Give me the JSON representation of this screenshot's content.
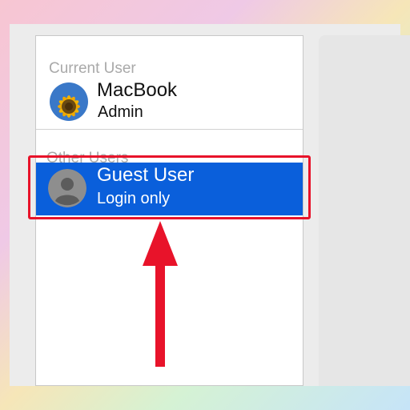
{
  "colors": {
    "selection": "#0a5fdb",
    "highlight": "#e8132a",
    "header_text": "#a9a9a9"
  },
  "users_panel": {
    "current_header": "Current User",
    "current_user": {
      "name": "MacBook",
      "role": "Admin",
      "avatar_icon": "sunflower-avatar-icon"
    },
    "other_header": "Other Users",
    "other_users": [
      {
        "name": "Guest User",
        "role": "Login only",
        "avatar_icon": "generic-person-avatar-icon",
        "selected": true
      }
    ]
  },
  "annotations": {
    "arrow_icon": "red-up-arrow-icon"
  }
}
